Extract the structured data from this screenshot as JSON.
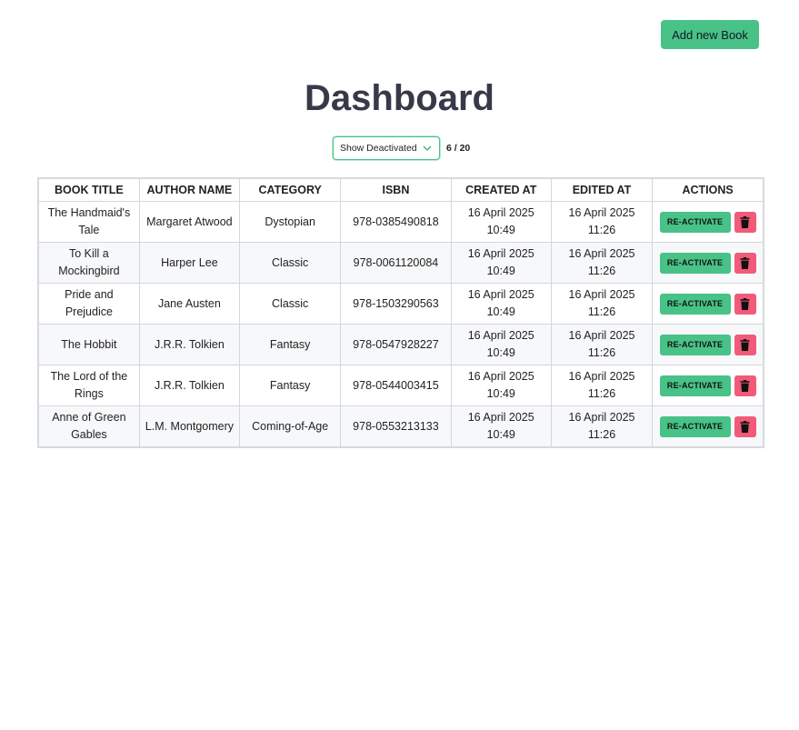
{
  "header": {
    "add_button_label": "Add new Book"
  },
  "page": {
    "title": "Dashboard"
  },
  "filter": {
    "selected": "Show Deactivated",
    "count": "6 / 20",
    "icon": "chevron-down-icon"
  },
  "table": {
    "columns": [
      "BOOK TITLE",
      "AUTHOR NAME",
      "CATEGORY",
      "ISBN",
      "CREATED AT",
      "EDITED AT",
      "ACTIONS"
    ],
    "rows": [
      {
        "title": "The Handmaid's Tale",
        "author": "Margaret Atwood",
        "category": "Dystopian",
        "isbn": "978-0385490818",
        "created": "16 April 2025 10:49",
        "edited": "16 April 2025 11:26",
        "action": "RE-ACTIVATE"
      },
      {
        "title": "To Kill a Mockingbird",
        "author": "Harper Lee",
        "category": "Classic",
        "isbn": "978-0061120084",
        "created": "16 April 2025 10:49",
        "edited": "16 April 2025 11:26",
        "action": "RE-ACTIVATE"
      },
      {
        "title": "Pride and Prejudice",
        "author": "Jane Austen",
        "category": "Classic",
        "isbn": "978-1503290563",
        "created": "16 April 2025 10:49",
        "edited": "16 April 2025 11:26",
        "action": "RE-ACTIVATE"
      },
      {
        "title": "The Hobbit",
        "author": "J.R.R. Tolkien",
        "category": "Fantasy",
        "isbn": "978-0547928227",
        "created": "16 April 2025 10:49",
        "edited": "16 April 2025 11:26",
        "action": "RE-ACTIVATE"
      },
      {
        "title": "The Lord of the Rings",
        "author": "J.R.R. Tolkien",
        "category": "Fantasy",
        "isbn": "978-0544003415",
        "created": "16 April 2025 10:49",
        "edited": "16 April 2025 11:26",
        "action": "RE-ACTIVATE"
      },
      {
        "title": "Anne of Green Gables",
        "author": "L.M. Montgomery",
        "category": "Coming-of-Age",
        "isbn": "978-0553213133",
        "created": "16 April 2025 10:49",
        "edited": "16 April 2025 11:26",
        "action": "RE-ACTIVATE"
      }
    ]
  },
  "colors": {
    "accent_green": "#48c287",
    "delete_red": "#f25a7a",
    "title_color": "#363a48"
  },
  "icons": {
    "delete": "trash-icon"
  }
}
